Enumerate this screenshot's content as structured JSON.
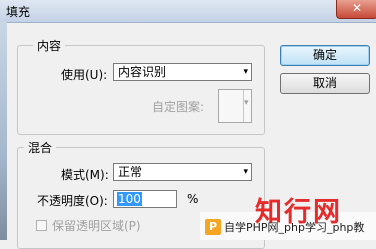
{
  "window": {
    "title": "填充",
    "close_glyph": "✕"
  },
  "content_group": {
    "legend": "内容",
    "use_label": "使用(U):",
    "use_value": "内容识别",
    "pattern_label": "自定图案:"
  },
  "blend_group": {
    "legend": "混合",
    "mode_label": "模式(M):",
    "mode_value": "正常",
    "opacity_label": "不透明度(O):",
    "opacity_value": "100",
    "opacity_unit": "%",
    "preserve_label": "保留透明区域(P)"
  },
  "buttons": {
    "ok": "确定",
    "cancel": "取消"
  },
  "watermark": {
    "big": "知行网",
    "icon": "P",
    "small": "自学PHP网_php学习_php教"
  },
  "colors": {
    "selection": "#3399ff",
    "watermark_red": "#e52b2b"
  },
  "icons": {
    "dropdown": "▾"
  }
}
